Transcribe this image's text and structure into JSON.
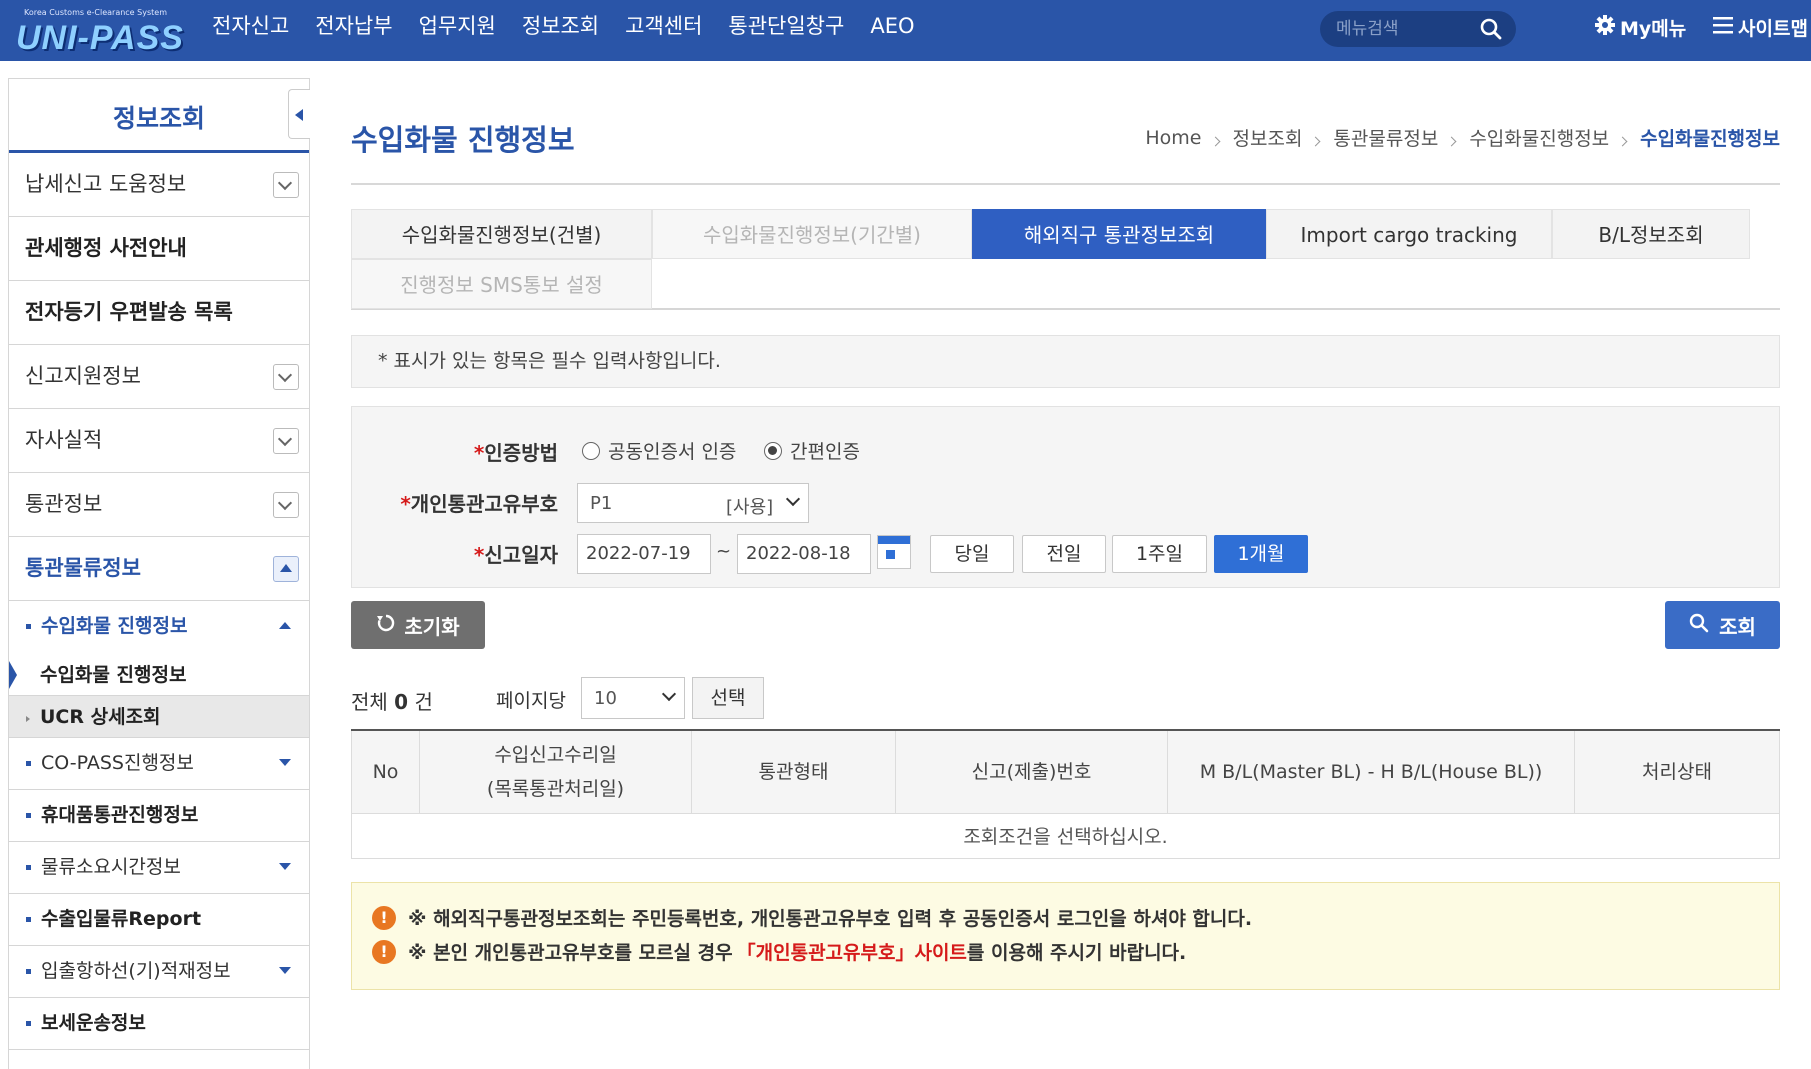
{
  "header": {
    "logo_small": "Korea Customs e-Clearance System",
    "logo_text": "UNI-PASS",
    "nav": [
      "전자신고",
      "전자납부",
      "업무지원",
      "정보조회",
      "고객센터",
      "통관단일창구",
      "AEO"
    ],
    "search_placeholder": "메뉴검색",
    "mymenu": "My메뉴",
    "sitemap": "사이트맵",
    "accent": "#2a55a8"
  },
  "sidebar": {
    "title": "정보조회",
    "items": [
      {
        "label": "납세신고 도움정보"
      },
      {
        "label": "관세행정 사전안내"
      },
      {
        "label": "전자등기 우편발송 목록"
      },
      {
        "label": "신고지원정보"
      },
      {
        "label": "자사실적"
      },
      {
        "label": "통관정보"
      },
      {
        "label": "통관물류정보"
      }
    ],
    "subs": [
      {
        "label": "수입화물 진행정보"
      },
      {
        "label": "수입화물 진행정보"
      },
      {
        "label": "UCR 상세조회"
      },
      {
        "label": "CO-PASS진행정보"
      },
      {
        "label": "휴대품통관진행정보"
      },
      {
        "label": "물류소요시간정보"
      },
      {
        "label": "수출입물류Report"
      },
      {
        "label": "입출항하선(기)적재정보"
      },
      {
        "label": "보세운송정보"
      }
    ]
  },
  "page": {
    "title": "수입화물 진행정보",
    "breadcrumb": [
      "Home",
      "정보조회",
      "통관물류정보",
      "수입화물진행정보",
      "수입화물진행정보"
    ]
  },
  "tabs": [
    {
      "label": "수입화물진행정보(건별)"
    },
    {
      "label": "수입화물진행정보(기간별)"
    },
    {
      "label": "해외직구 통관정보조회"
    },
    {
      "label": "Import cargo tracking"
    },
    {
      "label": "B/L정보조회"
    },
    {
      "label": "진행정보 SMS통보 설정"
    }
  ],
  "notice": "* 표시가 있는 항목은 필수 입력사항입니다.",
  "form": {
    "auth_label": "인증방법",
    "auth_options": [
      "공동인증서 인증",
      "간편인증"
    ],
    "pccc_label": "개인통관고유부호",
    "pccc_value": "P1",
    "pccc_status": "[사용]",
    "date_label": "신고일자",
    "date_from": "2022-07-19",
    "date_tilde": "~",
    "date_to": "2022-08-18",
    "period_buttons": [
      "당일",
      "전일",
      "1주일",
      "1개월"
    ],
    "required_mark": "*"
  },
  "actions": {
    "reset": "초기화",
    "search": "조회"
  },
  "list": {
    "total_prefix": "전체",
    "total_count": "0",
    "total_suffix": "건",
    "per_page_label": "페이지당",
    "per_page_value": "10",
    "select_button": "선택",
    "columns": [
      "No",
      "수입신고수리일",
      "(목록통관처리일)",
      "통관형태",
      "신고(제출)번호",
      "M B/L(Master BL) - H B/L(House BL))",
      "처리상태"
    ],
    "empty_message": "조회조건을 선택하십시오."
  },
  "warnings": {
    "line1": "※ 해외직구통관정보조회는 주민등록번호, 개인통관고유부호 입력 후 공동인증서 로그인을 하셔야 합니다.",
    "line2_a": "※ 본인 개인통관고유부호를 모르실 경우",
    "line2_link": "「개인통관고유부호」사이트",
    "line2_b": "를 이용해 주시기 바랍니다."
  }
}
